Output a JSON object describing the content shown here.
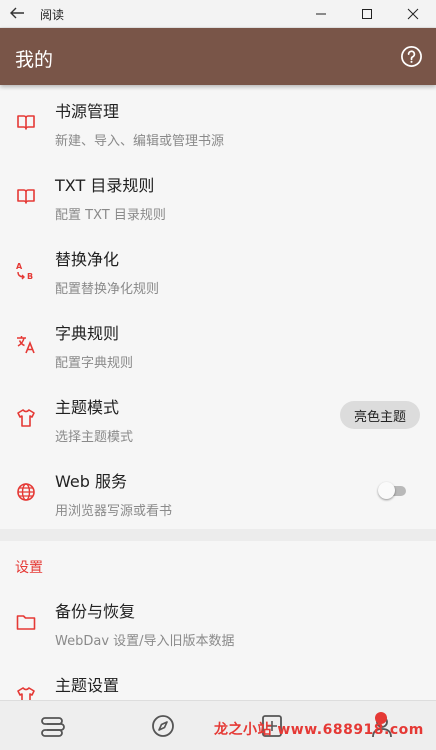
{
  "window": {
    "title": "阅读"
  },
  "appbar": {
    "title": "我的"
  },
  "menu": [
    {
      "icon": "book-icon",
      "title": "书源管理",
      "subtitle": "新建、导入、编辑或管理书源"
    },
    {
      "icon": "book-icon",
      "title": "TXT 目录规则",
      "subtitle": "配置 TXT 目录规则"
    },
    {
      "icon": "replace-icon",
      "title": "替换净化",
      "subtitle": "配置替换净化规则"
    },
    {
      "icon": "translate-icon",
      "title": "字典规则",
      "subtitle": "配置字典规则"
    },
    {
      "icon": "shirt-icon",
      "title": "主题模式",
      "subtitle": "选择主题模式",
      "value": "亮色主题"
    },
    {
      "icon": "globe-icon",
      "title": "Web 服务",
      "subtitle": "用浏览器写源或看书",
      "toggle": false
    }
  ],
  "settings": {
    "header": "设置",
    "items": [
      {
        "icon": "folder-icon",
        "title": "备份与恢复",
        "subtitle": "WebDav 设置/导入旧版本数据"
      },
      {
        "icon": "shirt-icon",
        "title": "主题设置",
        "subtitle": ""
      }
    ]
  },
  "bottom_nav": [
    {
      "icon": "bookshelf-icon"
    },
    {
      "icon": "compass-icon"
    },
    {
      "icon": "rss-icon"
    },
    {
      "icon": "person-icon",
      "badge": true
    }
  ],
  "watermark": "龙之小站 www.688918.com",
  "colors": {
    "appbar": "#795548",
    "accent": "#e53935",
    "background": "#f3f3f3"
  }
}
